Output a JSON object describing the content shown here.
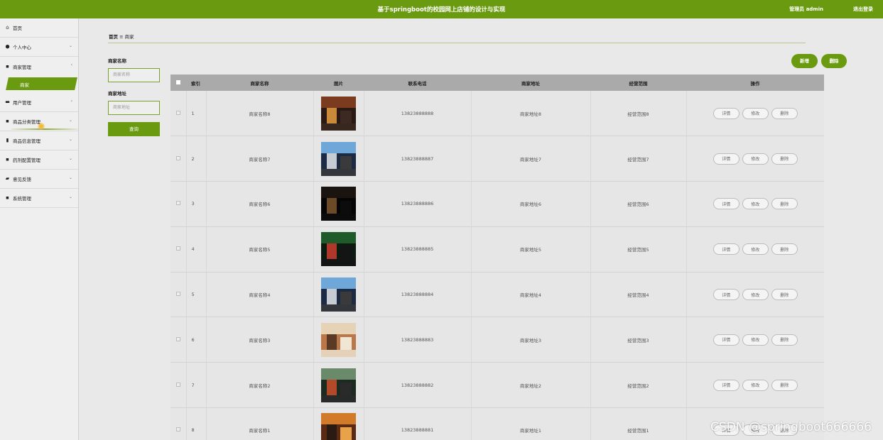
{
  "header": {
    "title": "基于springboot的校园网上店铺的设计与实现",
    "user": "管理员 admin",
    "logout": "退出登录"
  },
  "sidebar": {
    "items": [
      {
        "label": "首页",
        "icon": "home-icon"
      },
      {
        "label": "个人中心",
        "icon": "person-icon"
      },
      {
        "label": "商家管理",
        "icon": "grid-icon"
      },
      {
        "label": "商家",
        "icon": "none"
      },
      {
        "label": "用户管理",
        "icon": "card-icon"
      },
      {
        "label": "商品分类管理",
        "icon": "grid-icon"
      },
      {
        "label": "商品信息管理",
        "icon": "doc-icon"
      },
      {
        "label": "药剂配置管理",
        "icon": "grid-icon"
      },
      {
        "label": "意见反馈",
        "icon": "chat-icon"
      },
      {
        "label": "系统管理",
        "icon": "grid-icon"
      }
    ]
  },
  "breadcrumb": {
    "home": "首页",
    "sep": "≡",
    "current": "商家"
  },
  "filter": {
    "name_label": "商家名称",
    "name_placeholder": "商家名称",
    "addr_label": "商家地址",
    "addr_placeholder": "商家地址",
    "query": "查询"
  },
  "actions": {
    "add": "新增",
    "delete": "删除"
  },
  "table": {
    "headers": [
      "索引",
      "商家名称",
      "图片",
      "联系电话",
      "商家地址",
      "经营范围",
      "操作"
    ],
    "ops": {
      "detail": "详情",
      "edit": "修改",
      "delete": "删除"
    },
    "rows": [
      {
        "index": "1",
        "name": "商家名称8",
        "phone": "13823888888",
        "address": "商家地址8",
        "scope": "经营范围8",
        "img": "storefront-photo"
      },
      {
        "index": "2",
        "name": "商家名称7",
        "phone": "13823888887",
        "address": "商家地址7",
        "scope": "经营范围7",
        "img": "mall-atrium-photo"
      },
      {
        "index": "3",
        "name": "商家名称6",
        "phone": "13823888886",
        "address": "商家地址6",
        "scope": "经营范围6",
        "img": "night-shop-photo"
      },
      {
        "index": "4",
        "name": "商家名称5",
        "phone": "13823888885",
        "address": "商家地址5",
        "scope": "经营范围5",
        "img": "neon-mall-photo"
      },
      {
        "index": "5",
        "name": "商家名称4",
        "phone": "13823888884",
        "address": "商家地址4",
        "scope": "经营范围4",
        "img": "mall-atrium-photo"
      },
      {
        "index": "6",
        "name": "商家名称3",
        "phone": "13823888883",
        "address": "商家地址3",
        "scope": "经营范围3",
        "img": "reception-photo"
      },
      {
        "index": "7",
        "name": "商家名称2",
        "phone": "13823888882",
        "address": "商家地址2",
        "scope": "经营范围2",
        "img": "shop-front-photo"
      },
      {
        "index": "8",
        "name": "商家名称1",
        "phone": "13823888881",
        "address": "商家地址1",
        "scope": "经营范围1",
        "img": "counter-photo"
      }
    ]
  },
  "watermark": "CSDN @springboot666666",
  "colors": {
    "accent": "#6a9a0f",
    "table_header": "#aaaaaa",
    "background": "#e9e9e9"
  }
}
